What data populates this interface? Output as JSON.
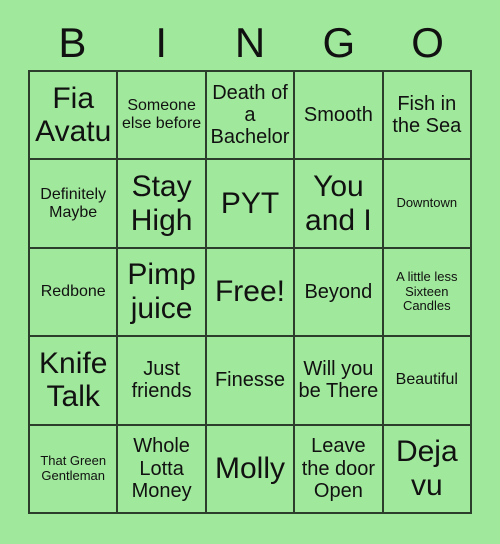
{
  "card": {
    "title_letters": [
      "B",
      "I",
      "N",
      "G",
      "O"
    ],
    "background_color": "#a0e89b",
    "border_color": "#2d3d2b",
    "text_color": "#111111",
    "rows": [
      [
        {
          "label": "Fia Avatu",
          "size": "sz-xl"
        },
        {
          "label": "Someone else before",
          "size": "sz-sm"
        },
        {
          "label": "Death of a Bachelor",
          "size": "sz-md"
        },
        {
          "label": "Smooth",
          "size": "sz-md"
        },
        {
          "label": "Fish in the Sea",
          "size": "sz-md"
        }
      ],
      [
        {
          "label": "Definitely Maybe",
          "size": "sz-sm"
        },
        {
          "label": "Stay High",
          "size": "sz-xl"
        },
        {
          "label": "PYT",
          "size": "sz-xl"
        },
        {
          "label": "You and I",
          "size": "sz-xl"
        },
        {
          "label": "Downtown",
          "size": "sz-xs"
        }
      ],
      [
        {
          "label": "Redbone",
          "size": "sz-sm"
        },
        {
          "label": "Pimp juice",
          "size": "sz-xl"
        },
        {
          "label": "Free!",
          "size": "sz-xl"
        },
        {
          "label": "Beyond",
          "size": "sz-md"
        },
        {
          "label": "A little less Sixteen Candles",
          "size": "sz-xs"
        }
      ],
      [
        {
          "label": "Knife Talk",
          "size": "sz-xl"
        },
        {
          "label": "Just friends",
          "size": "sz-md"
        },
        {
          "label": "Finesse",
          "size": "sz-md"
        },
        {
          "label": "Will you be There",
          "size": "sz-md"
        },
        {
          "label": "Beautiful",
          "size": "sz-sm"
        }
      ],
      [
        {
          "label": "That Green Gentleman",
          "size": "sz-xs"
        },
        {
          "label": "Whole Lotta Money",
          "size": "sz-md"
        },
        {
          "label": "Molly",
          "size": "sz-xl"
        },
        {
          "label": "Leave the door Open",
          "size": "sz-md"
        },
        {
          "label": "Deja vu",
          "size": "sz-xl"
        }
      ]
    ]
  }
}
